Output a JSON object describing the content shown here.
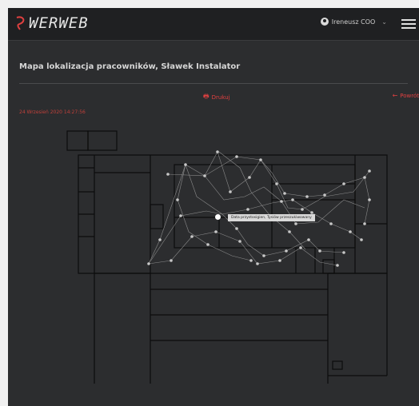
{
  "app": {
    "logo_text": "WERWEB"
  },
  "header": {
    "user_name": "Ireneusz COO",
    "dropdown_icon": "chevron-down-icon",
    "menu_icon": "hamburger-icon"
  },
  "page": {
    "title": "Mapa lokalizacja pracowników, Sławek Instalator",
    "print_label": "Drukuj",
    "back_label": "Powrót",
    "timestamp": "24 Wrzesień 2020 14:27:56"
  },
  "map": {
    "tooltip": "Data przystosigien, Tysiów przeszukiwowany"
  },
  "colors": {
    "accent": "#e04040",
    "background": "#2c2d2f",
    "topbar": "#1f2022"
  }
}
